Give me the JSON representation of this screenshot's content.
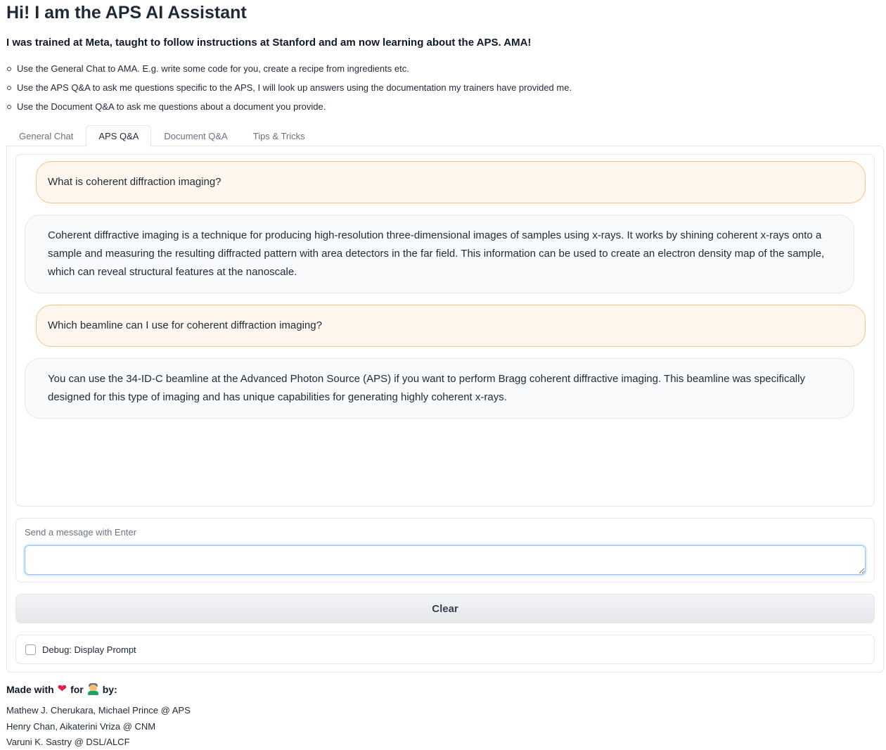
{
  "header": {
    "title": "Hi! I am the APS AI Assistant",
    "subtitle": "I was trained at Meta, taught to follow instructions at Stanford and am now learning about the APS. AMA!",
    "bullets": [
      "Use the General Chat to AMA. E.g. write some code for you, create a recipe from ingredients etc.",
      "Use the APS Q&A to ask me questions specific to the APS, I will look up answers using the documentation my trainers have provided me.",
      "Use the Document Q&A to ask me questions about a document you provide."
    ]
  },
  "tabs": [
    {
      "label": "General Chat",
      "active": false
    },
    {
      "label": "APS Q&A",
      "active": true
    },
    {
      "label": "Document Q&A",
      "active": false
    },
    {
      "label": "Tips & Tricks",
      "active": false
    }
  ],
  "chat": {
    "messages": [
      {
        "role": "user",
        "text": "What is coherent diffraction imaging?"
      },
      {
        "role": "bot",
        "text": "Coherent diffractive imaging is a technique for producing high-resolution three-dimensional images of samples using x-rays. It works by shining coherent x-rays onto a sample and measuring the resulting diffracted pattern with area detectors in the far field. This information can be used to create an electron density map of the sample, which can reveal structural features at the nanoscale."
      },
      {
        "role": "user",
        "text": "Which beamline can I use for coherent diffraction imaging?"
      },
      {
        "role": "bot",
        "text": "You can use the 34-ID-C beamline at the Advanced Photon Source (APS) if you want to perform Bragg coherent diffractive imaging. This beamline was specifically designed for this type of imaging and has unique capabilities for generating highly coherent x-rays."
      }
    ]
  },
  "input": {
    "label": "Send a message with Enter",
    "value": ""
  },
  "controls": {
    "clear_label": "Clear",
    "debug_label": "Debug: Display Prompt",
    "debug_checked": false
  },
  "footer": {
    "made_with": "Made with",
    "for": "for",
    "by": "by:",
    "heart_icon": "heart-icon",
    "scientist_icon": "scientist-icon",
    "credits": [
      "Mathew J. Cherukara, Michael Prince @ APS",
      "Henry Chan, Aikaterini Vriza @ CNM",
      "Varuni K. Sastry @ DSL/ALCF"
    ]
  },
  "colors": {
    "user_bubble": "#fff7ed",
    "user_border": "#f6c58a",
    "bot_bubble": "#f9fafb",
    "input_focus": "#93c5fd"
  }
}
